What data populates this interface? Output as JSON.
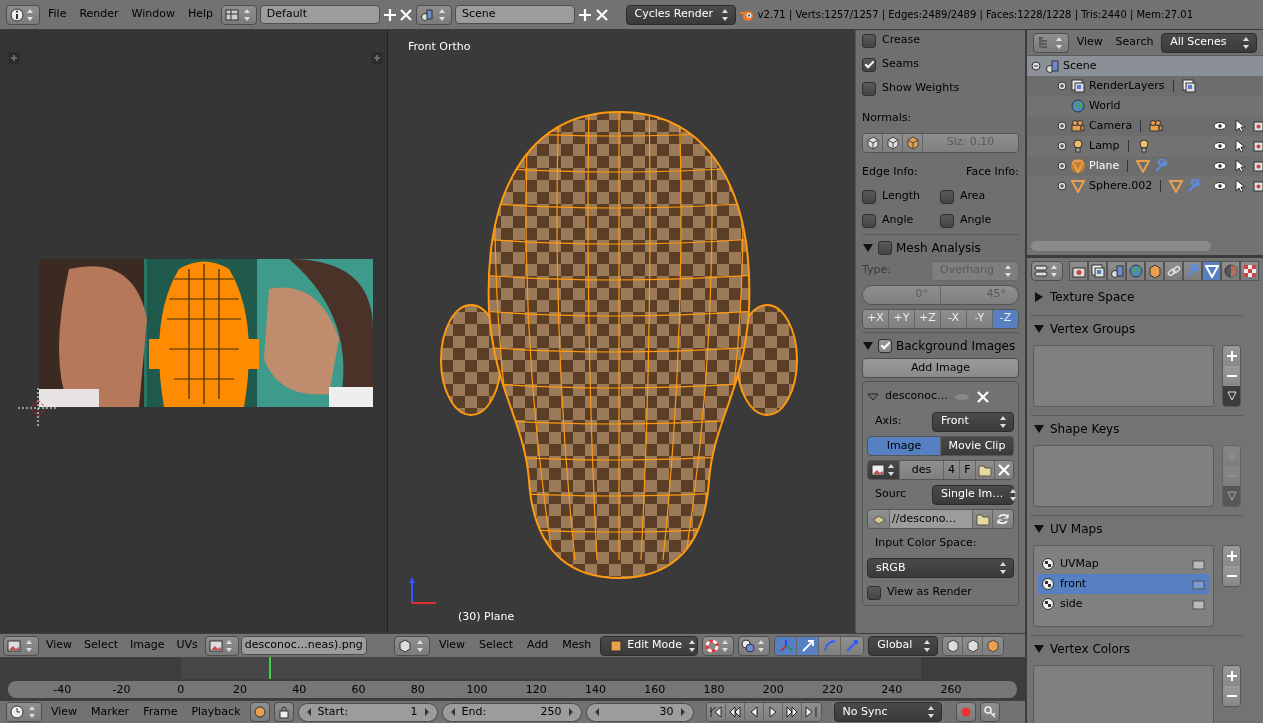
{
  "top_bar": {
    "menus": [
      "File",
      "Render",
      "Window",
      "Help"
    ],
    "layout": "Default",
    "scene": "Scene",
    "engine": "Cycles Render",
    "stats": "v2.71 | Verts:1257/1257 | Edges:2489/2489 | Faces:1228/1228 | Tris:2440 | Mem:27.01"
  },
  "uv_editor": {
    "header": {
      "menus": [
        "View",
        "Select",
        "Image",
        "UVs"
      ],
      "image": "desconoc…neas).png"
    }
  },
  "viewport": {
    "view_label": "Front Ortho",
    "object_label": "(30) Plane",
    "header": {
      "menus": [
        "View",
        "Select",
        "Add",
        "Mesh"
      ],
      "mode": "Edit Mode",
      "manipulators": [
        {
          "kind": "axes",
          "selected": true
        },
        {
          "kind": "translate",
          "selected": true
        },
        {
          "kind": "rotate",
          "selected": false
        },
        {
          "kind": "scale",
          "selected": false
        }
      ],
      "orientation": "Global"
    }
  },
  "n_panel": {
    "overlay_checks": [
      {
        "label": "Crease",
        "checked": false
      },
      {
        "label": "Seams",
        "checked": true
      },
      {
        "label": "Show Weights",
        "checked": false
      }
    ],
    "normals_label": "Normals:",
    "normal_size": "Siz:  0.10",
    "edge_info_label": "Edge Info:",
    "face_info_label": "Face Info:",
    "edge_checks": [
      {
        "label": "Length",
        "checked": false
      },
      {
        "label": "Angle",
        "checked": false
      }
    ],
    "face_checks": [
      {
        "label": "Area",
        "checked": false
      },
      {
        "label": "Angle",
        "checked": false
      }
    ],
    "mesh_analysis": {
      "title": "Mesh Analysis",
      "expanded": true,
      "enabled": false,
      "type_label": "Type:",
      "type": "Overhang",
      "range": [
        "0°",
        "45°"
      ],
      "axes": [
        {
          "label": "+X",
          "selected": false
        },
        {
          "label": "+Y",
          "selected": false
        },
        {
          "label": "+Z",
          "selected": false
        },
        {
          "label": "-X",
          "selected": false
        },
        {
          "label": "-Y",
          "selected": false
        },
        {
          "label": "-Z",
          "selected": true
        }
      ]
    },
    "background_images": {
      "title": "Background Images",
      "expanded": true,
      "enabled": true,
      "add_button": "Add Image",
      "image": {
        "name": "desconoc…",
        "expanded": true,
        "axis_label": "Axis:",
        "axis": "Front",
        "source_tabs": [
          {
            "label": "Image",
            "selected": true
          },
          {
            "label": "Movie Clip",
            "selected": false
          }
        ],
        "datablock": "des",
        "users": "4",
        "fake_user": "F",
        "source_label": "Sourc",
        "source": "Single Im…",
        "filepath": "//descono…",
        "color_space_label": "Input Color Space:",
        "color_space": "sRGB",
        "view_as_render": {
          "label": "View as Render",
          "checked": false
        }
      }
    }
  },
  "outliner": {
    "menus": [
      "View",
      "Search"
    ],
    "filter": "All Scenes",
    "tree": [
      {
        "label": "Scene",
        "kind": "scene",
        "selected": true,
        "active": false,
        "expanded": true,
        "children": [
          {
            "label": "RenderLayers",
            "kind": "renderlayers",
            "selected": false,
            "active": false,
            "modifier": false
          },
          {
            "label": "World",
            "kind": "world",
            "selected": false,
            "active": false
          },
          {
            "label": "Camera",
            "kind": "camera",
            "selected": false,
            "active": false,
            "modifier": false
          },
          {
            "label": "Lamp",
            "kind": "lamp",
            "selected": false,
            "active": false,
            "modifier": false
          },
          {
            "label": "Plane",
            "kind": "mesh",
            "selected": false,
            "active": true,
            "modifier": true
          },
          {
            "label": "Sphere.002",
            "kind": "mesh",
            "selected": false,
            "active": false,
            "modifier": true
          }
        ]
      }
    ]
  },
  "properties": {
    "tabs": [
      {
        "kind": "render",
        "selected": false
      },
      {
        "kind": "renderlayers",
        "selected": false
      },
      {
        "kind": "scene",
        "selected": false
      },
      {
        "kind": "world",
        "selected": false
      },
      {
        "kind": "object",
        "selected": false
      },
      {
        "kind": "constraints",
        "selected": false
      },
      {
        "kind": "modifiers",
        "selected": false
      },
      {
        "kind": "data",
        "selected": true
      },
      {
        "kind": "material",
        "selected": false
      },
      {
        "kind": "texture",
        "selected": false
      }
    ],
    "panels": [
      {
        "title": "Texture Space",
        "kind": "plain",
        "expanded": false
      },
      {
        "title": "Vertex Groups",
        "kind": "list_specials",
        "expanded": true,
        "disabled": false
      },
      {
        "title": "Shape Keys",
        "kind": "list_specials",
        "expanded": true,
        "disabled": true
      },
      {
        "title": "UV Maps",
        "kind": "list",
        "expanded": true,
        "disabled": false,
        "items": [
          {
            "label": "UVMap",
            "selected": false
          },
          {
            "label": "front",
            "selected": true
          },
          {
            "label": "side",
            "selected": false
          }
        ]
      },
      {
        "title": "Vertex Colors",
        "kind": "list",
        "expanded": true,
        "disabled": false
      }
    ]
  },
  "timeline": {
    "ticks": [
      "-40",
      "-20",
      "0",
      "20",
      "40",
      "60",
      "80",
      "100",
      "120",
      "140",
      "160",
      "180",
      "200",
      "220",
      "240",
      "260"
    ],
    "header": {
      "menus": [
        "View",
        "Marker",
        "Frame",
        "Playback"
      ],
      "start_label": "Start:",
      "start": "1",
      "end_label": "End:",
      "end": "250",
      "frame": "30",
      "sync": "No Sync"
    }
  }
}
